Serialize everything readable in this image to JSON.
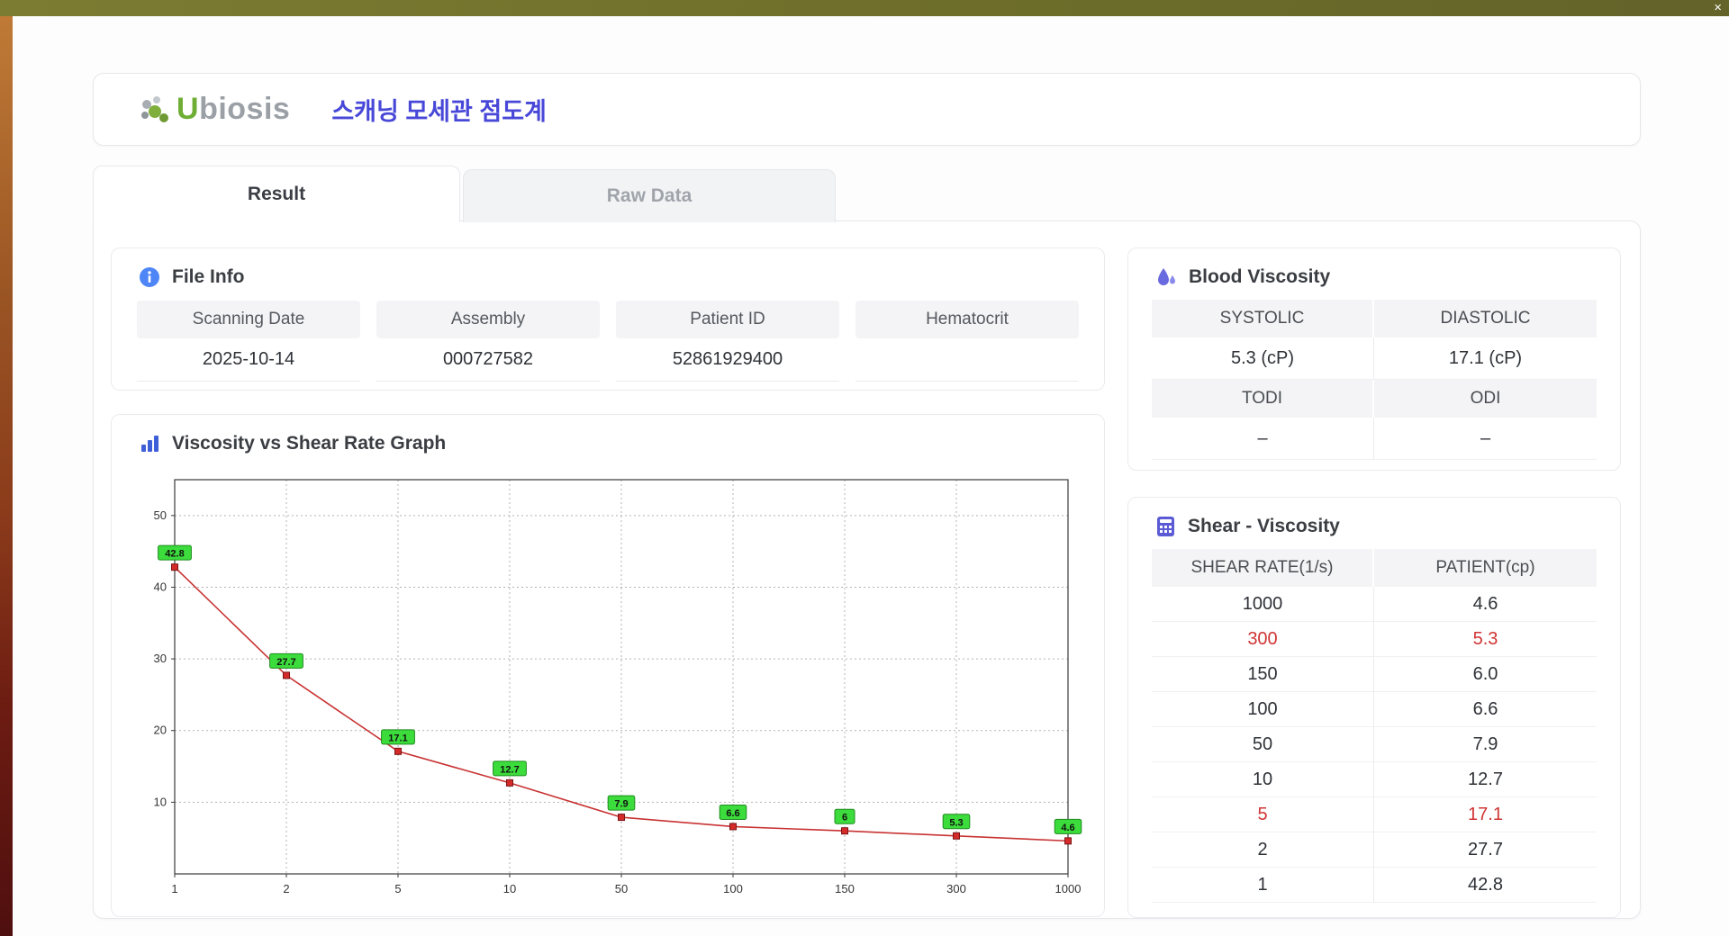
{
  "window": {
    "close_label": "×"
  },
  "header": {
    "logo_u": "U",
    "logo_rest": "biosis",
    "title": "스캐닝 모세관 점도계"
  },
  "tabs": [
    {
      "label": "Result"
    },
    {
      "label": "Raw Data"
    }
  ],
  "file_info": {
    "title": "File Info",
    "fields": [
      {
        "label": "Scanning Date",
        "value": "2025-10-14"
      },
      {
        "label": "Assembly",
        "value": "000727582"
      },
      {
        "label": "Patient ID",
        "value": "52861929400"
      },
      {
        "label": "Hematocrit",
        "value": ""
      }
    ]
  },
  "blood_viscosity": {
    "title": "Blood Viscosity",
    "headers1": [
      "SYSTOLIC",
      "DIASTOLIC"
    ],
    "values1": [
      "5.3 (cP)",
      "17.1 (cP)"
    ],
    "headers2": [
      "TODI",
      "ODI"
    ],
    "values2": [
      "–",
      "–"
    ]
  },
  "shear_table": {
    "title": "Shear - Viscosity",
    "columns": [
      "SHEAR RATE(1/s)",
      "PATIENT(cp)"
    ],
    "rows": [
      {
        "shear": "1000",
        "patient": "4.6",
        "highlight": false
      },
      {
        "shear": "300",
        "patient": "5.3",
        "highlight": true
      },
      {
        "shear": "150",
        "patient": "6.0",
        "highlight": false
      },
      {
        "shear": "100",
        "patient": "6.6",
        "highlight": false
      },
      {
        "shear": "50",
        "patient": "7.9",
        "highlight": false
      },
      {
        "shear": "10",
        "patient": "12.7",
        "highlight": false
      },
      {
        "shear": "5",
        "patient": "17.1",
        "highlight": true
      },
      {
        "shear": "2",
        "patient": "27.7",
        "highlight": false
      },
      {
        "shear": "1",
        "patient": "42.8",
        "highlight": false
      }
    ]
  },
  "chart_data": {
    "type": "line",
    "title": "Viscosity vs Shear Rate Graph",
    "x_scale": "categorical",
    "x": [
      1,
      2,
      5,
      10,
      50,
      100,
      150,
      300,
      1000
    ],
    "x_ticks": [
      "1",
      "2",
      "5",
      "10",
      "50",
      "100",
      "150",
      "300",
      "1000"
    ],
    "values": [
      42.8,
      27.7,
      17.1,
      12.7,
      7.9,
      6.6,
      6,
      5.3,
      4.6
    ],
    "point_labels": [
      "42.8",
      "27.7",
      "17.1",
      "12.7",
      "7.9",
      "6.6",
      "6",
      "5.3",
      "4.6"
    ],
    "y_ticks": [
      10,
      20,
      30,
      40,
      50
    ],
    "ylim": [
      0,
      55
    ],
    "grid": "dotted",
    "xlabel": "",
    "ylabel": "",
    "line_color": "#c83232",
    "marker_color": "#d42a2a",
    "marker_border": "#7a1515",
    "label_bg": "#3bdc3b",
    "label_border": "#1f8a1f"
  },
  "colors": {
    "accent_title": "#4848d8",
    "logo_green": "#6fae35",
    "logo_gray": "#9aa0a6",
    "highlight_red": "#d03434",
    "top_bar": "#6d6d2a"
  }
}
